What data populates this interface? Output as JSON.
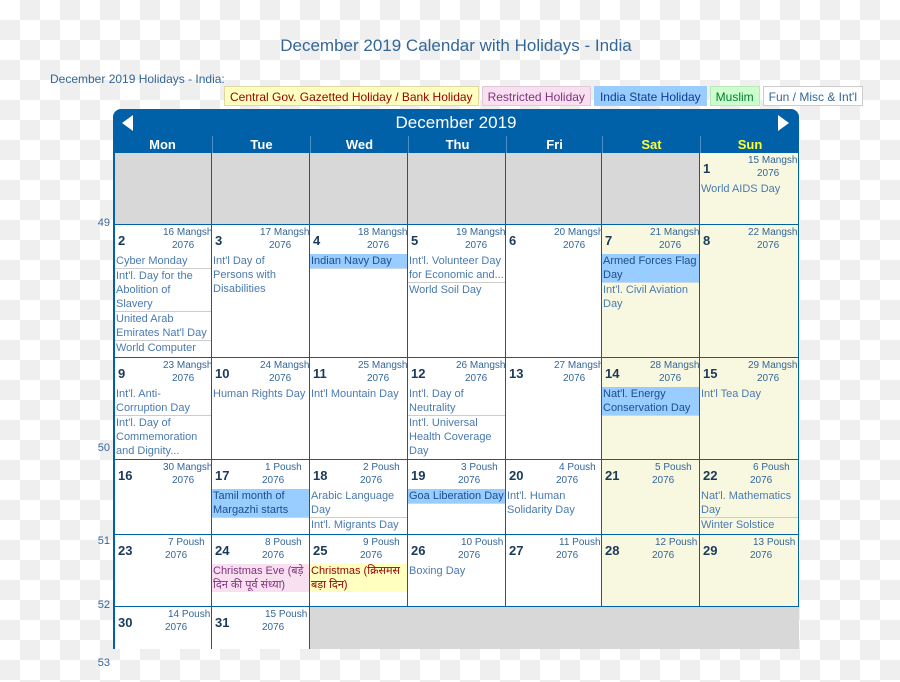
{
  "page_title": "December 2019 Calendar with Holidays - India",
  "holidays_label": "December 2019 Holidays - India:",
  "legend": [
    {
      "label": "Central Gov. Gazetted Holiday / Bank Holiday",
      "type": "gov"
    },
    {
      "label": "Restricted Holiday",
      "type": "res"
    },
    {
      "label": "India State Holiday",
      "type": "state"
    },
    {
      "label": "Muslim",
      "type": "mus"
    },
    {
      "label": "Fun / Misc & Int'l",
      "type": "fun"
    }
  ],
  "colors": {
    "header_blue": "#0060a8",
    "weekend_header": "#ffff33",
    "weekend_cell": "#f8f8e0",
    "empty_cell": "#d8d8d8",
    "state_holiday": "#99ccff",
    "restricted_holiday": "#f8e0f0",
    "gazetted_holiday": "#ffffc0"
  },
  "calendar": {
    "month_title": "December 2019",
    "prev_icon": "triangle-left",
    "next_icon": "triangle-right",
    "weekdays": [
      "Mon",
      "Tue",
      "Wed",
      "Thu",
      "Fri",
      "Sat",
      "Sun"
    ],
    "weeks": [
      {
        "week_number": "49",
        "days": [
          null,
          null,
          null,
          null,
          null,
          null,
          {
            "day": "1",
            "nepali_date": "15 Mangshir",
            "nepali_year": "2076",
            "events": [
              {
                "text": "World AIDS Day",
                "type": "fun"
              }
            ]
          }
        ]
      },
      {
        "week_number": "50",
        "days": [
          {
            "day": "2",
            "nepali_date": "16 Mangshir",
            "nepali_year": "2076",
            "events": [
              {
                "text": "Cyber Monday",
                "type": "fun"
              },
              {
                "text": "Int'l. Day for the Abolition of Slavery",
                "type": "fun"
              },
              {
                "text": "United Arab Emirates Nat'l Day",
                "type": "fun"
              },
              {
                "text": "World Computer Literacy Day",
                "type": "fun"
              }
            ]
          },
          {
            "day": "3",
            "nepali_date": "17 Mangshir",
            "nepali_year": "2076",
            "events": [
              {
                "text": "Int'l Day of Persons with Disabilities",
                "type": "fun"
              }
            ]
          },
          {
            "day": "4",
            "nepali_date": "18 Mangshir",
            "nepali_year": "2076",
            "events": [
              {
                "text": "Indian Navy Day",
                "type": "state"
              }
            ]
          },
          {
            "day": "5",
            "nepali_date": "19 Mangshir",
            "nepali_year": "2076",
            "events": [
              {
                "text": "Int'l. Volunteer Day for Economic and...",
                "type": "fun"
              },
              {
                "text": "World Soil Day",
                "type": "fun"
              }
            ]
          },
          {
            "day": "6",
            "nepali_date": "20 Mangshir",
            "nepali_year": "2076",
            "events": []
          },
          {
            "day": "7",
            "nepali_date": "21 Mangshir",
            "nepali_year": "2076",
            "events": [
              {
                "text": "Armed Forces Flag Day",
                "type": "state"
              },
              {
                "text": "Int'l. Civil Aviation Day",
                "type": "fun"
              }
            ]
          },
          {
            "day": "8",
            "nepali_date": "22 Mangshir",
            "nepali_year": "2076",
            "events": []
          }
        ]
      },
      {
        "week_number": "51",
        "days": [
          {
            "day": "9",
            "nepali_date": "23 Mangshir",
            "nepali_year": "2076",
            "events": [
              {
                "text": "Int'l. Anti-Corruption Day",
                "type": "fun"
              },
              {
                "text": "Int'l. Day of Commemoration and Dignity...",
                "type": "fun"
              }
            ]
          },
          {
            "day": "10",
            "nepali_date": "24 Mangshir",
            "nepali_year": "2076",
            "events": [
              {
                "text": "Human Rights Day",
                "type": "fun"
              }
            ]
          },
          {
            "day": "11",
            "nepali_date": "25 Mangshir",
            "nepali_year": "2076",
            "events": [
              {
                "text": "Int'l Mountain Day",
                "type": "fun"
              }
            ]
          },
          {
            "day": "12",
            "nepali_date": "26 Mangshir",
            "nepali_year": "2076",
            "events": [
              {
                "text": "Int'l. Day of Neutrality",
                "type": "fun"
              },
              {
                "text": "Int'l. Universal Health Coverage Day",
                "type": "fun"
              }
            ]
          },
          {
            "day": "13",
            "nepali_date": "27 Mangshir",
            "nepali_year": "2076",
            "events": []
          },
          {
            "day": "14",
            "nepali_date": "28 Mangshir",
            "nepali_year": "2076",
            "events": [
              {
                "text": "Nat'l. Energy Conservation Day",
                "type": "state"
              }
            ]
          },
          {
            "day": "15",
            "nepali_date": "29 Mangshir",
            "nepali_year": "2076",
            "events": [
              {
                "text": "Int'l Tea Day",
                "type": "fun"
              }
            ]
          }
        ]
      },
      {
        "week_number": "52",
        "days": [
          {
            "day": "16",
            "nepali_date": "30 Mangshir",
            "nepali_year": "2076",
            "events": []
          },
          {
            "day": "17",
            "nepali_date": "1 Poush",
            "nepali_year": "2076",
            "events": [
              {
                "text": "Tamil month of Margazhi starts",
                "type": "state"
              }
            ]
          },
          {
            "day": "18",
            "nepali_date": "2 Poush",
            "nepali_year": "2076",
            "events": [
              {
                "text": "Arabic Language Day",
                "type": "fun"
              },
              {
                "text": "Int'l. Migrants Day",
                "type": "fun"
              }
            ]
          },
          {
            "day": "19",
            "nepali_date": "3 Poush",
            "nepali_year": "2076",
            "events": [
              {
                "text": "Goa Liberation Day",
                "type": "state"
              }
            ]
          },
          {
            "day": "20",
            "nepali_date": "4 Poush",
            "nepali_year": "2076",
            "events": [
              {
                "text": "Int'l. Human Solidarity Day",
                "type": "fun"
              }
            ]
          },
          {
            "day": "21",
            "nepali_date": "5 Poush",
            "nepali_year": "2076",
            "events": []
          },
          {
            "day": "22",
            "nepali_date": "6 Poush",
            "nepali_year": "2076",
            "events": [
              {
                "text": "Nat'l. Mathematics Day",
                "type": "fun"
              },
              {
                "text": "Winter Solstice",
                "type": "fun"
              }
            ]
          }
        ]
      },
      {
        "week_number": "53",
        "days": [
          {
            "day": "23",
            "nepali_date": "7 Poush",
            "nepali_year": "2076",
            "events": []
          },
          {
            "day": "24",
            "nepali_date": "8 Poush",
            "nepali_year": "2076",
            "events": [
              {
                "text": "Christmas Eve (बड़े दिन की पूर्व संध्या)",
                "type": "res"
              }
            ]
          },
          {
            "day": "25",
            "nepali_date": "9 Poush",
            "nepali_year": "2076",
            "events": [
              {
                "text": "Christmas (क्रिसमस बड़ा दिन)",
                "type": "gov"
              }
            ]
          },
          {
            "day": "26",
            "nepali_date": "10 Poush",
            "nepali_year": "2076",
            "events": [
              {
                "text": "Boxing Day",
                "type": "fun"
              }
            ]
          },
          {
            "day": "27",
            "nepali_date": "11 Poush",
            "nepali_year": "2076",
            "events": []
          },
          {
            "day": "28",
            "nepali_date": "12 Poush",
            "nepali_year": "2076",
            "events": []
          },
          {
            "day": "29",
            "nepali_date": "13 Poush",
            "nepali_year": "2076",
            "events": []
          }
        ]
      },
      {
        "week_number": "",
        "days": [
          {
            "day": "30",
            "nepali_date": "14 Poush",
            "nepali_year": "2076",
            "events": []
          },
          {
            "day": "31",
            "nepali_date": "15 Poush",
            "nepali_year": "2076",
            "events": []
          },
          null,
          null,
          null,
          null,
          null
        ]
      }
    ]
  }
}
